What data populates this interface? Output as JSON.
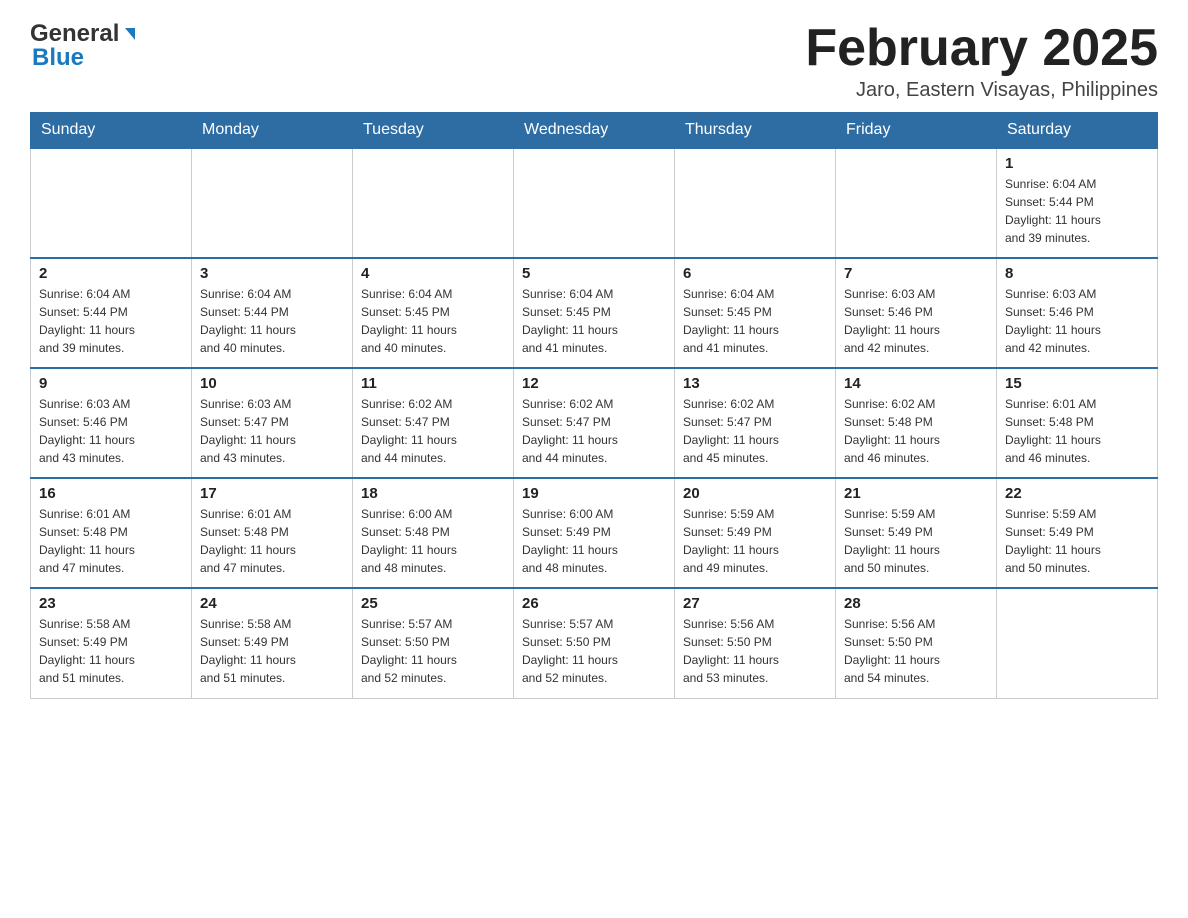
{
  "header": {
    "logo_general": "General",
    "logo_blue": "Blue",
    "month_title": "February 2025",
    "location": "Jaro, Eastern Visayas, Philippines"
  },
  "days_of_week": [
    "Sunday",
    "Monday",
    "Tuesday",
    "Wednesday",
    "Thursday",
    "Friday",
    "Saturday"
  ],
  "weeks": [
    [
      {
        "day": "",
        "info": ""
      },
      {
        "day": "",
        "info": ""
      },
      {
        "day": "",
        "info": ""
      },
      {
        "day": "",
        "info": ""
      },
      {
        "day": "",
        "info": ""
      },
      {
        "day": "",
        "info": ""
      },
      {
        "day": "1",
        "info": "Sunrise: 6:04 AM\nSunset: 5:44 PM\nDaylight: 11 hours\nand 39 minutes."
      }
    ],
    [
      {
        "day": "2",
        "info": "Sunrise: 6:04 AM\nSunset: 5:44 PM\nDaylight: 11 hours\nand 39 minutes."
      },
      {
        "day": "3",
        "info": "Sunrise: 6:04 AM\nSunset: 5:44 PM\nDaylight: 11 hours\nand 40 minutes."
      },
      {
        "day": "4",
        "info": "Sunrise: 6:04 AM\nSunset: 5:45 PM\nDaylight: 11 hours\nand 40 minutes."
      },
      {
        "day": "5",
        "info": "Sunrise: 6:04 AM\nSunset: 5:45 PM\nDaylight: 11 hours\nand 41 minutes."
      },
      {
        "day": "6",
        "info": "Sunrise: 6:04 AM\nSunset: 5:45 PM\nDaylight: 11 hours\nand 41 minutes."
      },
      {
        "day": "7",
        "info": "Sunrise: 6:03 AM\nSunset: 5:46 PM\nDaylight: 11 hours\nand 42 minutes."
      },
      {
        "day": "8",
        "info": "Sunrise: 6:03 AM\nSunset: 5:46 PM\nDaylight: 11 hours\nand 42 minutes."
      }
    ],
    [
      {
        "day": "9",
        "info": "Sunrise: 6:03 AM\nSunset: 5:46 PM\nDaylight: 11 hours\nand 43 minutes."
      },
      {
        "day": "10",
        "info": "Sunrise: 6:03 AM\nSunset: 5:47 PM\nDaylight: 11 hours\nand 43 minutes."
      },
      {
        "day": "11",
        "info": "Sunrise: 6:02 AM\nSunset: 5:47 PM\nDaylight: 11 hours\nand 44 minutes."
      },
      {
        "day": "12",
        "info": "Sunrise: 6:02 AM\nSunset: 5:47 PM\nDaylight: 11 hours\nand 44 minutes."
      },
      {
        "day": "13",
        "info": "Sunrise: 6:02 AM\nSunset: 5:47 PM\nDaylight: 11 hours\nand 45 minutes."
      },
      {
        "day": "14",
        "info": "Sunrise: 6:02 AM\nSunset: 5:48 PM\nDaylight: 11 hours\nand 46 minutes."
      },
      {
        "day": "15",
        "info": "Sunrise: 6:01 AM\nSunset: 5:48 PM\nDaylight: 11 hours\nand 46 minutes."
      }
    ],
    [
      {
        "day": "16",
        "info": "Sunrise: 6:01 AM\nSunset: 5:48 PM\nDaylight: 11 hours\nand 47 minutes."
      },
      {
        "day": "17",
        "info": "Sunrise: 6:01 AM\nSunset: 5:48 PM\nDaylight: 11 hours\nand 47 minutes."
      },
      {
        "day": "18",
        "info": "Sunrise: 6:00 AM\nSunset: 5:48 PM\nDaylight: 11 hours\nand 48 minutes."
      },
      {
        "day": "19",
        "info": "Sunrise: 6:00 AM\nSunset: 5:49 PM\nDaylight: 11 hours\nand 48 minutes."
      },
      {
        "day": "20",
        "info": "Sunrise: 5:59 AM\nSunset: 5:49 PM\nDaylight: 11 hours\nand 49 minutes."
      },
      {
        "day": "21",
        "info": "Sunrise: 5:59 AM\nSunset: 5:49 PM\nDaylight: 11 hours\nand 50 minutes."
      },
      {
        "day": "22",
        "info": "Sunrise: 5:59 AM\nSunset: 5:49 PM\nDaylight: 11 hours\nand 50 minutes."
      }
    ],
    [
      {
        "day": "23",
        "info": "Sunrise: 5:58 AM\nSunset: 5:49 PM\nDaylight: 11 hours\nand 51 minutes."
      },
      {
        "day": "24",
        "info": "Sunrise: 5:58 AM\nSunset: 5:49 PM\nDaylight: 11 hours\nand 51 minutes."
      },
      {
        "day": "25",
        "info": "Sunrise: 5:57 AM\nSunset: 5:50 PM\nDaylight: 11 hours\nand 52 minutes."
      },
      {
        "day": "26",
        "info": "Sunrise: 5:57 AM\nSunset: 5:50 PM\nDaylight: 11 hours\nand 52 minutes."
      },
      {
        "day": "27",
        "info": "Sunrise: 5:56 AM\nSunset: 5:50 PM\nDaylight: 11 hours\nand 53 minutes."
      },
      {
        "day": "28",
        "info": "Sunrise: 5:56 AM\nSunset: 5:50 PM\nDaylight: 11 hours\nand 54 minutes."
      },
      {
        "day": "",
        "info": ""
      }
    ]
  ]
}
